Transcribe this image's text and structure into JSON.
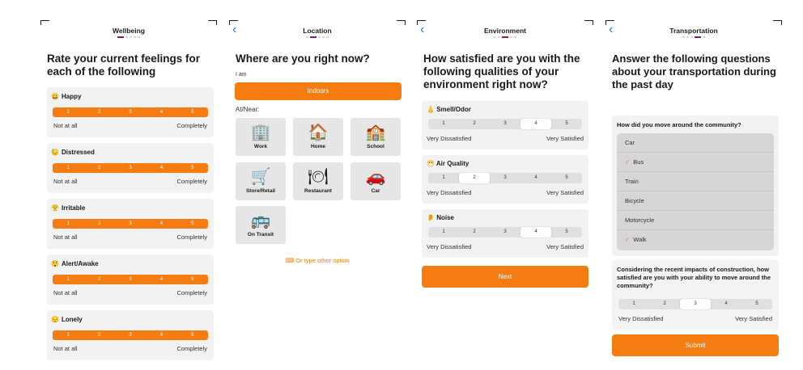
{
  "screens": {
    "wellbeing": {
      "header": "Wellbeing",
      "title": "Rate your current feelings for each of the following",
      "scale": [
        "1",
        "2",
        "3",
        "4",
        "5"
      ],
      "low_label": "Not at all",
      "high_label": "Completely",
      "items": [
        {
          "emoji": "😀",
          "label": "Happy"
        },
        {
          "emoji": "😓",
          "label": "Distressed"
        },
        {
          "emoji": "😤",
          "label": "Irritable"
        },
        {
          "emoji": "😲",
          "label": "Alert/Awake"
        },
        {
          "emoji": "😔",
          "label": "Lonely"
        }
      ]
    },
    "location": {
      "header": "Location",
      "title": "Where are you right now?",
      "i_am": "I am",
      "selected": "Indoors",
      "at_near": "At/Near:",
      "options": [
        {
          "icon": "🏢",
          "label": "Work"
        },
        {
          "icon": "🏠",
          "label": "Home"
        },
        {
          "icon": "🏫",
          "label": "School"
        },
        {
          "icon": "🛒",
          "label": "Store/Retail"
        },
        {
          "icon": "🍽",
          "label": "Restaurant"
        },
        {
          "icon": "🚗",
          "label": "Car"
        },
        {
          "icon": "🚌",
          "label": "On Transit"
        }
      ],
      "type_other": "⌨ Or type other option"
    },
    "environment": {
      "header": "Environment",
      "title": "How satisfied are you with the following qualities of your environment right now?",
      "scale": [
        "1",
        "2",
        "3",
        "4",
        "5"
      ],
      "low_label": "Very Dissatisfied",
      "high_label": "Very Satisfied",
      "items": [
        {
          "emoji": "👃",
          "label": "Smell/Odor",
          "selected": 4
        },
        {
          "emoji": "😷",
          "label": "Air Quality",
          "selected": 2
        },
        {
          "emoji": "👂",
          "label": "Noise",
          "selected": 4
        }
      ],
      "next": "Next"
    },
    "transportation": {
      "header": "Transportation",
      "title": "Answer the following questions about your transportation during the past day",
      "q1": "How did you move around the community?",
      "modes": [
        {
          "label": "Car",
          "checked": false
        },
        {
          "label": "Bus",
          "checked": true
        },
        {
          "label": "Train",
          "checked": false
        },
        {
          "label": "Bicycle",
          "checked": false
        },
        {
          "label": "Motorcycle",
          "checked": false
        },
        {
          "label": "Walk",
          "checked": true
        }
      ],
      "q2": "Considering the recent impacts of construction, how satisfied are you with your ability to move around the community?",
      "scale": [
        "1",
        "2",
        "3",
        "4",
        "5"
      ],
      "q2_selected": 3,
      "low_label": "Very Dissatisfied",
      "high_label": "Very Satisfied",
      "submit": "Submit"
    }
  },
  "colors": {
    "accent": "#f57c10",
    "progress": "#7a1f6e",
    "back": "#1877f2"
  }
}
